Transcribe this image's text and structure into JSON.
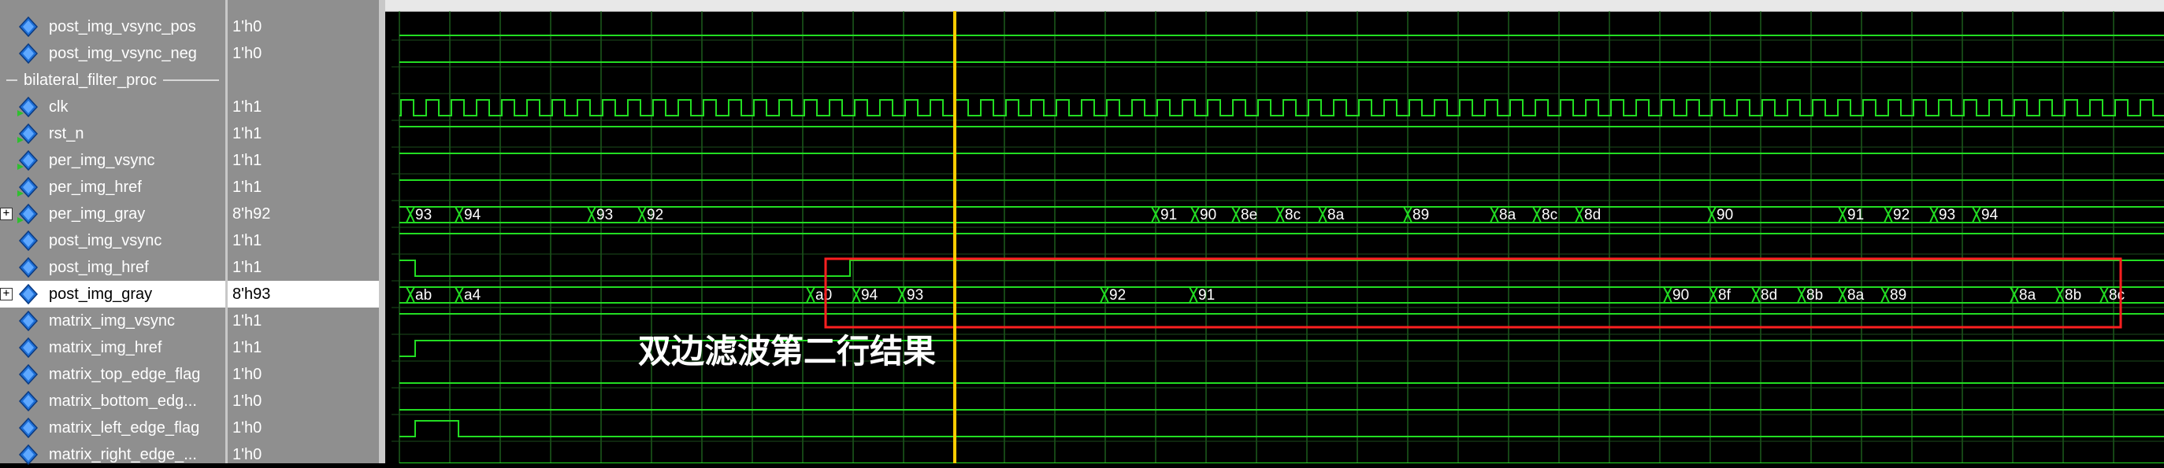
{
  "signals": [
    {
      "name": "post_img_vsync_pos",
      "value": "1'h0",
      "icon": "signal-out-icon",
      "type": "bit",
      "level": 0
    },
    {
      "name": "post_img_vsync_neg",
      "value": "1'h0",
      "icon": "signal-out-icon",
      "type": "bit",
      "level": 0
    },
    {
      "group": "bilateral_filter_proc"
    },
    {
      "name": "clk",
      "value": "1'h1",
      "icon": "signal-in-icon",
      "type": "clock"
    },
    {
      "name": "rst_n",
      "value": "1'h1",
      "icon": "signal-in-icon",
      "type": "bit",
      "level": 1
    },
    {
      "name": "per_img_vsync",
      "value": "1'h1",
      "icon": "signal-in-icon",
      "type": "bit",
      "level": 1
    },
    {
      "name": "per_img_href",
      "value": "1'h1",
      "icon": "signal-in-icon",
      "type": "bit",
      "level": 1
    },
    {
      "name": "per_img_gray",
      "value": "8'h92",
      "icon": "signal-in-icon",
      "type": "bus",
      "expander": "+",
      "labels": [
        "93",
        "94",
        "93",
        "92",
        "91",
        "90",
        "8e",
        "8c",
        "8a",
        "89",
        "8a",
        "8c",
        "8d",
        "90",
        "91",
        "92",
        "93",
        "94"
      ]
    },
    {
      "name": "post_img_vsync",
      "value": "1'h1",
      "icon": "signal-out-icon",
      "type": "bit",
      "level": 1
    },
    {
      "name": "post_img_href",
      "value": "1'h1",
      "icon": "signal-out-icon",
      "type": "href"
    },
    {
      "name": "post_img_gray",
      "value": "8'h93",
      "icon": "signal-out-icon",
      "type": "bus",
      "expander": "+",
      "selected": true,
      "labels": [
        "ab",
        "a4",
        "a0",
        "94",
        "93",
        "92",
        "91",
        "90",
        "8f",
        "8d",
        "8b",
        "8a",
        "89",
        "8a",
        "8b",
        "8c"
      ]
    },
    {
      "name": "matrix_img_vsync",
      "value": "1'h1",
      "icon": "signal-out-icon",
      "type": "bit",
      "level": 1
    },
    {
      "name": "matrix_img_href",
      "value": "1'h1",
      "icon": "signal-out-icon",
      "type": "rise"
    },
    {
      "name": "matrix_top_edge_flag",
      "value": "1'h0",
      "icon": "signal-out-icon",
      "type": "bit",
      "level": 0
    },
    {
      "name": "matrix_bottom_edg...",
      "value": "1'h0",
      "icon": "signal-out-icon",
      "type": "bit",
      "level": 0
    },
    {
      "name": "matrix_left_edge_flag",
      "value": "1'h0",
      "icon": "signal-out-icon",
      "type": "pulse"
    },
    {
      "name": "matrix_right_edge_...",
      "value": "1'h0",
      "icon": "signal-out-icon",
      "type": "bit",
      "level": 0
    }
  ],
  "annotation": "双边滤波第二行结果",
  "colors": {
    "wave": "#22dd22",
    "grid": "#2a8a2a",
    "cursor": "#ffcc00",
    "box": "#ff2020",
    "panel": "#8f8f8f",
    "icon": "#1f6fd6"
  }
}
